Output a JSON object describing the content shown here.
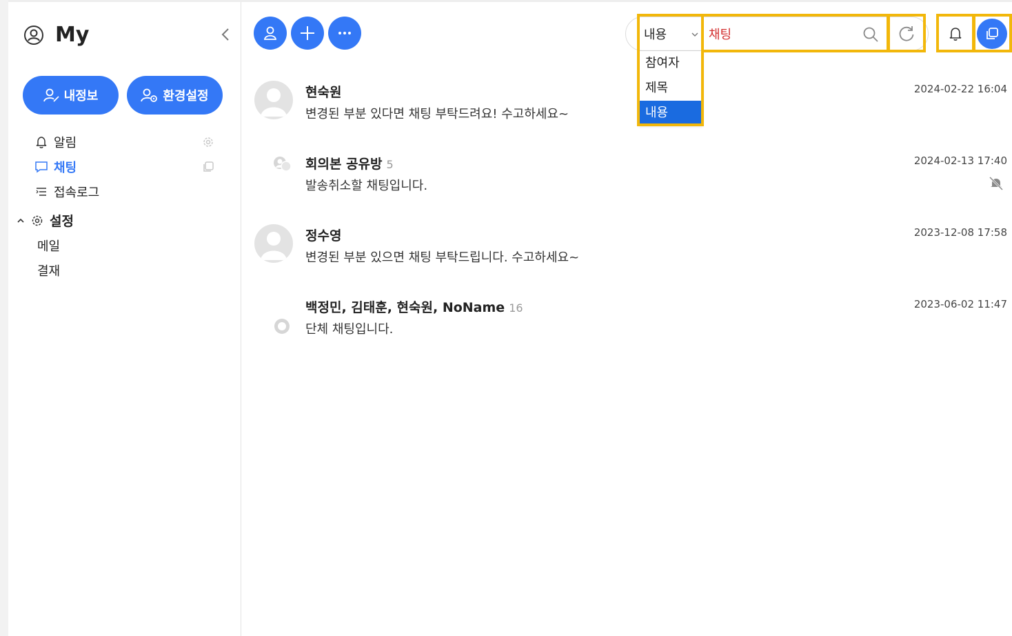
{
  "sidebar": {
    "title": "My",
    "profile_button": "내정보",
    "settings_button": "환경설정",
    "nav": [
      {
        "label": "알림",
        "icon": "bell-icon"
      },
      {
        "label": "채팅",
        "icon": "chat-icon",
        "active": true
      },
      {
        "label": "접속로그",
        "icon": "list-icon"
      }
    ],
    "settings_group": {
      "label": "설정",
      "expanded": true,
      "items": [
        "메일",
        "결재"
      ]
    }
  },
  "toolbar": {
    "search_scope_selected": "내용",
    "search_scope_options": [
      "참여자",
      "제목",
      "내용"
    ],
    "search_query": "채팅",
    "action_icons": [
      "person-icon",
      "plus-icon",
      "more-icon",
      "search-icon",
      "refresh-icon",
      "bell-icon",
      "new-chat-icon"
    ]
  },
  "chats": [
    {
      "name": "현숙원",
      "count": "",
      "message": "변경된 부분 있다면 채팅 부탁드려요! 수고하세요~",
      "time": "2024-02-22 16:04",
      "muted": false,
      "group": false
    },
    {
      "name": "회의본 공유방",
      "count": "5",
      "message": "발송취소할 채팅입니다.",
      "time": "2024-02-13 17:40",
      "muted": true,
      "group": true
    },
    {
      "name": "정수영",
      "count": "",
      "message": "변경된 부분 있으면 채팅 부탁드립니다. 수고하세요~",
      "time": "2023-12-08 17:58",
      "muted": false,
      "group": false
    },
    {
      "name": "백정민, 김태훈, 현숙원, NoName",
      "count": "16",
      "message": "단체 채팅입니다.",
      "time": "2023-06-02 11:47",
      "muted": false,
      "group": true
    }
  ],
  "colors": {
    "accent": "#3478f6",
    "highlight": "#f2b70a",
    "selected_option": "#1a6be0",
    "query_text": "#d32f2f"
  }
}
